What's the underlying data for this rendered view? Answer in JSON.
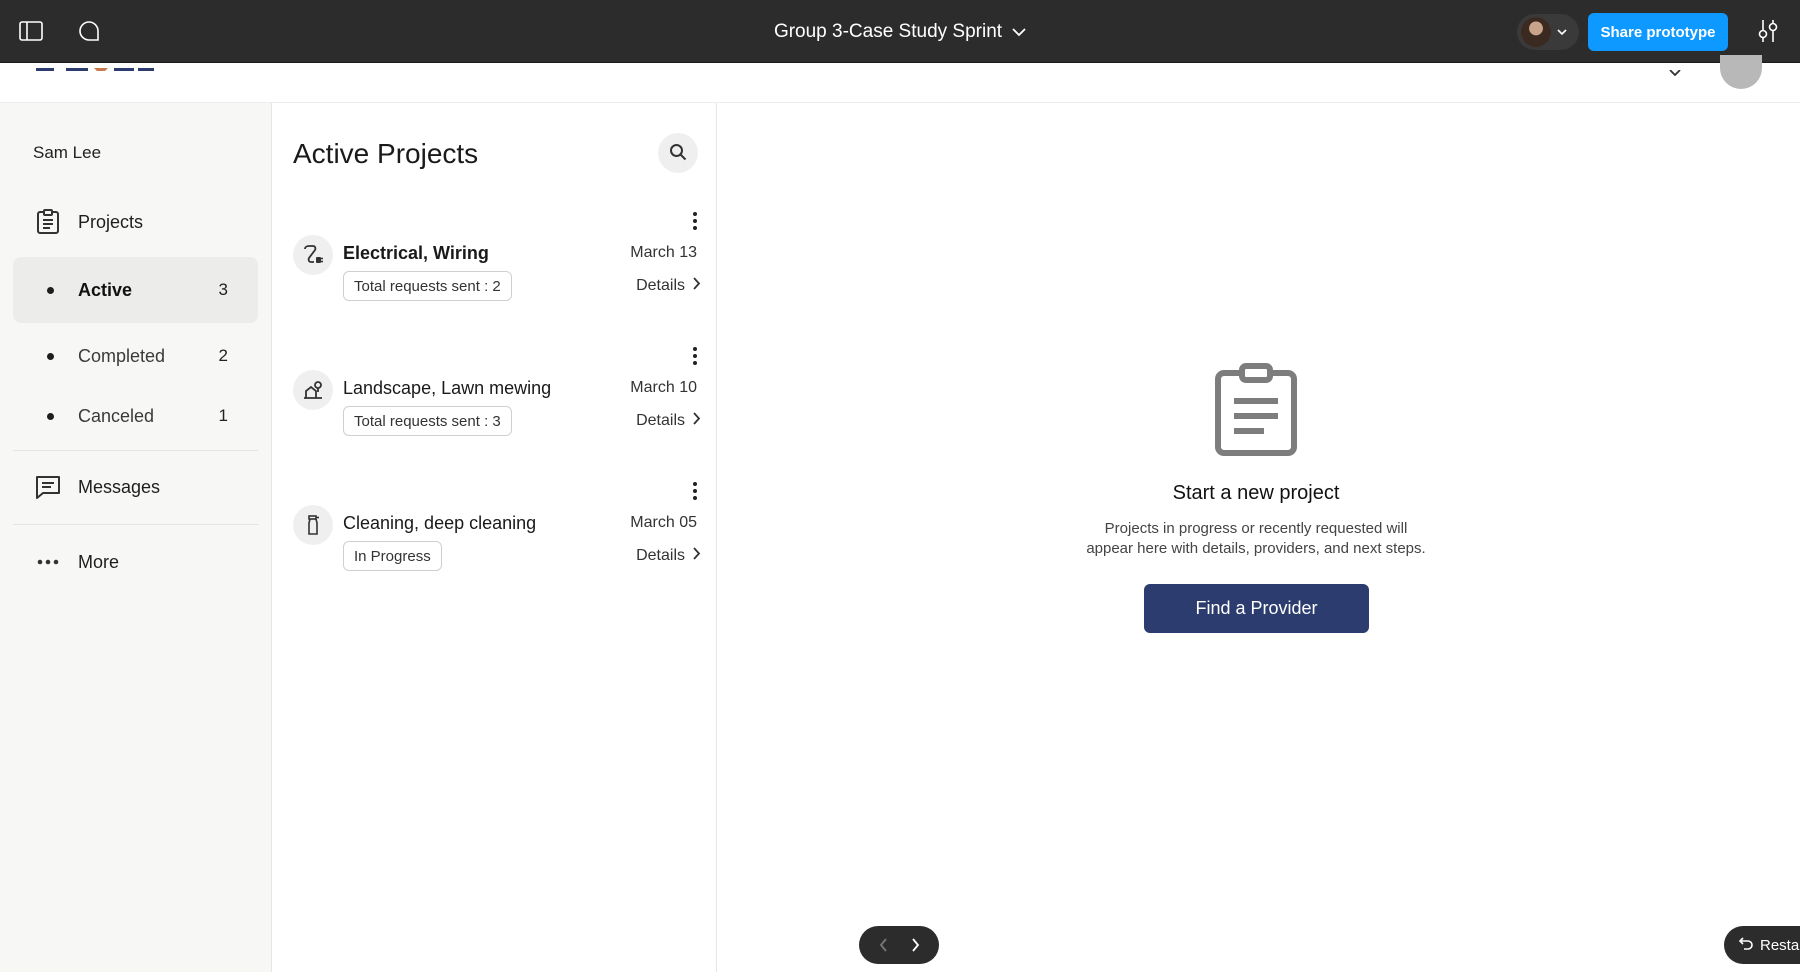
{
  "topbar": {
    "file_title": "Group 3-Case Study Sprint",
    "share_label": "Share prototype",
    "icons": [
      "sidebar-toggle-icon",
      "comment-icon",
      "chevron-down-icon",
      "settings-sliders-icon"
    ]
  },
  "sidebar": {
    "user_name": "Sam Lee",
    "projects_label": "Projects",
    "sub_items": [
      {
        "label": "Active",
        "count": "3"
      },
      {
        "label": "Completed",
        "count": "2"
      },
      {
        "label": "Canceled",
        "count": "1"
      }
    ],
    "messages_label": "Messages",
    "more_label": "More"
  },
  "list": {
    "title": "Active Projects",
    "projects": [
      {
        "name": "Electrical, Wiring",
        "date": "March 13",
        "badge": "Total requests sent : 2",
        "details": "Details",
        "icon": "plug-icon"
      },
      {
        "name": "Landscape, Lawn mewing",
        "date": "March 10",
        "badge": "Total requests sent : 3",
        "details": "Details",
        "icon": "landscape-icon"
      },
      {
        "name": "Cleaning, deep cleaning",
        "date": "March 05",
        "badge": "In Progress",
        "details": "Details",
        "icon": "spray-bottle-icon"
      }
    ]
  },
  "empty_state": {
    "title": "Start a new project",
    "description_line1": "Projects in progress or recently requested will",
    "description_line2": "appear here with details, providers, and next steps.",
    "button_label": "Find a Provider"
  },
  "bottom": {
    "restart_label": "Resta"
  },
  "colors": {
    "topbar_bg": "#2c2c2c",
    "share_blue": "#0d99ff",
    "primary_navy": "#2c3c6e",
    "sidebar_bg": "#f7f7f6",
    "active_item_bg": "#ececeb"
  }
}
